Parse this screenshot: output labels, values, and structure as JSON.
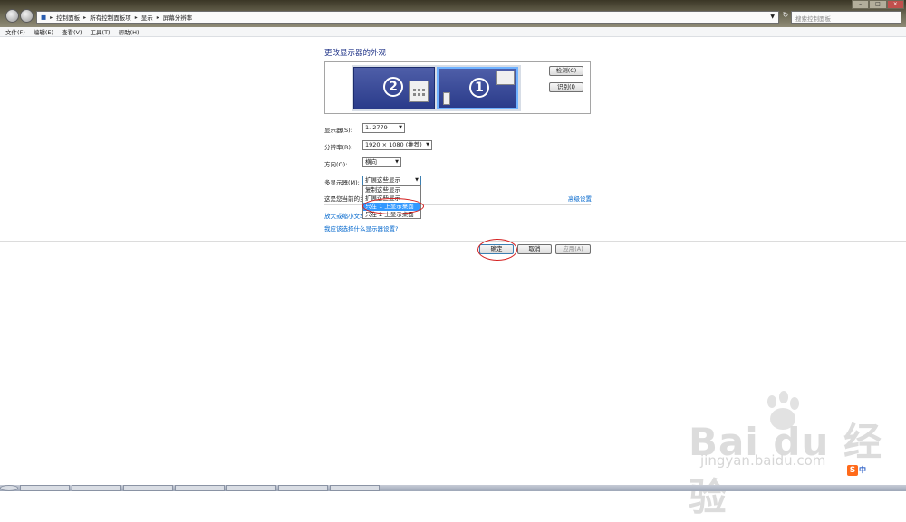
{
  "breadcrumbs": [
    "控制面板",
    "所有控制面板项",
    "显示",
    "屏幕分辨率"
  ],
  "search_placeholder": "搜索控制面板",
  "menu": [
    "文件(F)",
    "编辑(E)",
    "查看(V)",
    "工具(T)",
    "帮助(H)"
  ],
  "heading": "更改显示器的外观",
  "monitors": [
    {
      "number": "2"
    },
    {
      "number": "1"
    }
  ],
  "buttons": {
    "detect": "检测(C)",
    "identify": "识别(I)",
    "ok": "确定",
    "cancel": "取消",
    "apply": "应用(A)"
  },
  "fields": {
    "display_label": "显示器(S):",
    "display_value": "1. 2779",
    "resolution_label": "分辨率(R):",
    "resolution_value": "1920 × 1080 (推荐)",
    "orientation_label": "方向(O):",
    "orientation_value": "横向",
    "multi_label": "多显示器(M):",
    "multi_value": "扩展这些显示"
  },
  "dropdown_options": [
    "复制这些显示",
    "扩展这些显示",
    "只在 1 上显示桌面",
    "只在 2 上显示桌面"
  ],
  "dropdown_selected_index": 2,
  "description": "这是您当前的主",
  "advanced_link": "高级设置",
  "link_text_size": "放大或缩小文本",
  "link_which": "我应该选择什么显示器设置?",
  "watermark": {
    "logo": "Bai du 经验",
    "url": "jingyan.baidu.com"
  },
  "ime": {
    "icon": "S",
    "lang": "中"
  },
  "colors": {
    "highlight": "#3399ff",
    "annotation": "#d42020",
    "link": "#0066cc"
  }
}
